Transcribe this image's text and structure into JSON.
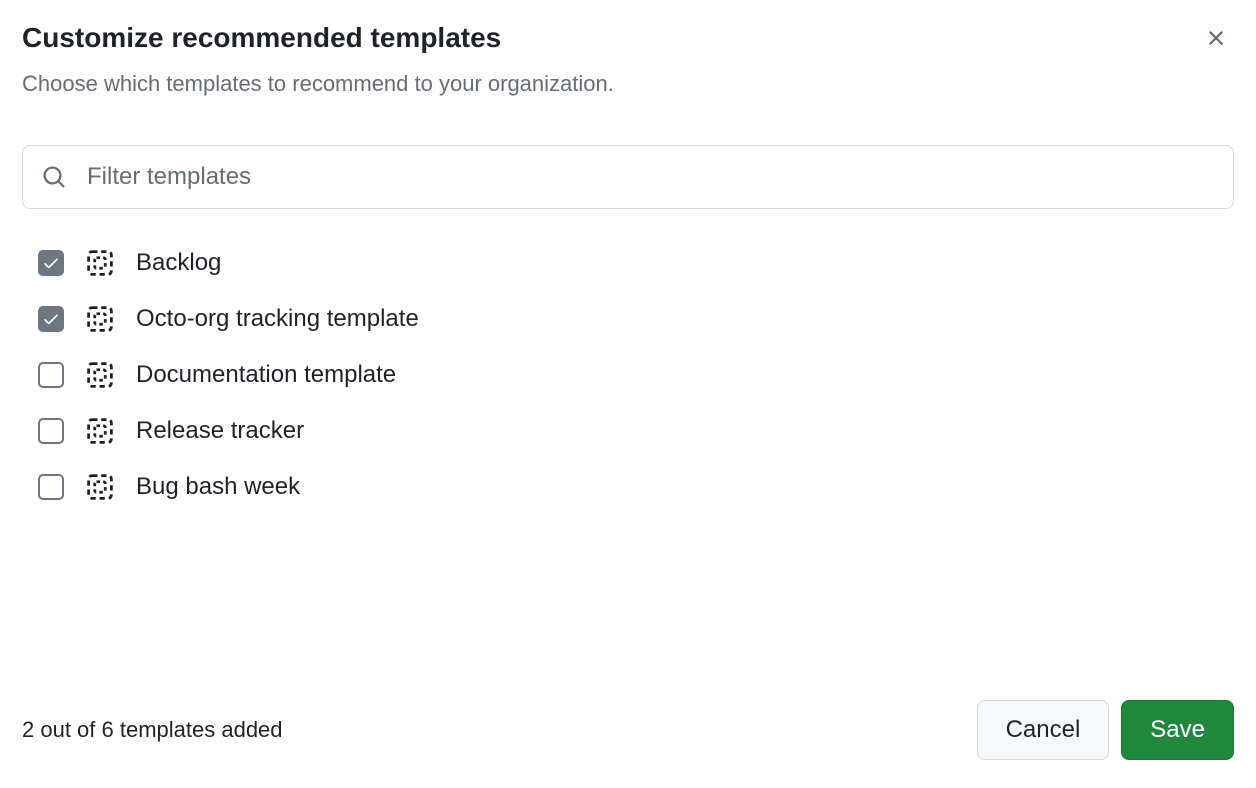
{
  "dialog": {
    "title": "Customize recommended templates",
    "subtitle": "Choose which templates to recommend to your organization."
  },
  "search": {
    "placeholder": "Filter templates",
    "value": ""
  },
  "templates": [
    {
      "label": "Backlog",
      "checked": true
    },
    {
      "label": "Octo-org tracking template",
      "checked": true
    },
    {
      "label": "Documentation template",
      "checked": false
    },
    {
      "label": "Release tracker",
      "checked": false
    },
    {
      "label": "Bug bash week",
      "checked": false
    }
  ],
  "footer": {
    "status": "2 out of 6 templates added",
    "cancel_label": "Cancel",
    "save_label": "Save"
  }
}
